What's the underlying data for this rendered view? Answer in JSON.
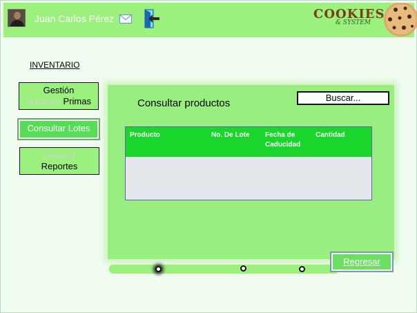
{
  "header": {
    "user_name": "Juan Carlos Pérez",
    "logo_line1": "COOKIES",
    "logo_line2": "& SYSTEM"
  },
  "sidebar": {
    "section_title": "INVENTARIO",
    "items": [
      {
        "line1": "Gestión",
        "line2_faded": "Materias",
        "line2": "Primas"
      },
      {
        "label": "Consultar Lotes",
        "active": true
      },
      {
        "line1_faded": "Generar",
        "line2": "Reportes"
      }
    ]
  },
  "main": {
    "title": "Consultar productos",
    "search_placeholder": "Buscar...",
    "table": {
      "columns": [
        "Producto",
        "No. De Lote",
        "Fecha de Caducidad",
        "Cantidad"
      ],
      "rows": []
    },
    "pagination_dots": 3,
    "active_dot": 1,
    "back_label": "Regresar"
  },
  "colors": {
    "header_bg": "#9bf07e",
    "panel_bg": "#98ef7f",
    "table_header": "#1ad62c",
    "active_button": "#56dd58",
    "page_bg": "#f1fcf0"
  }
}
